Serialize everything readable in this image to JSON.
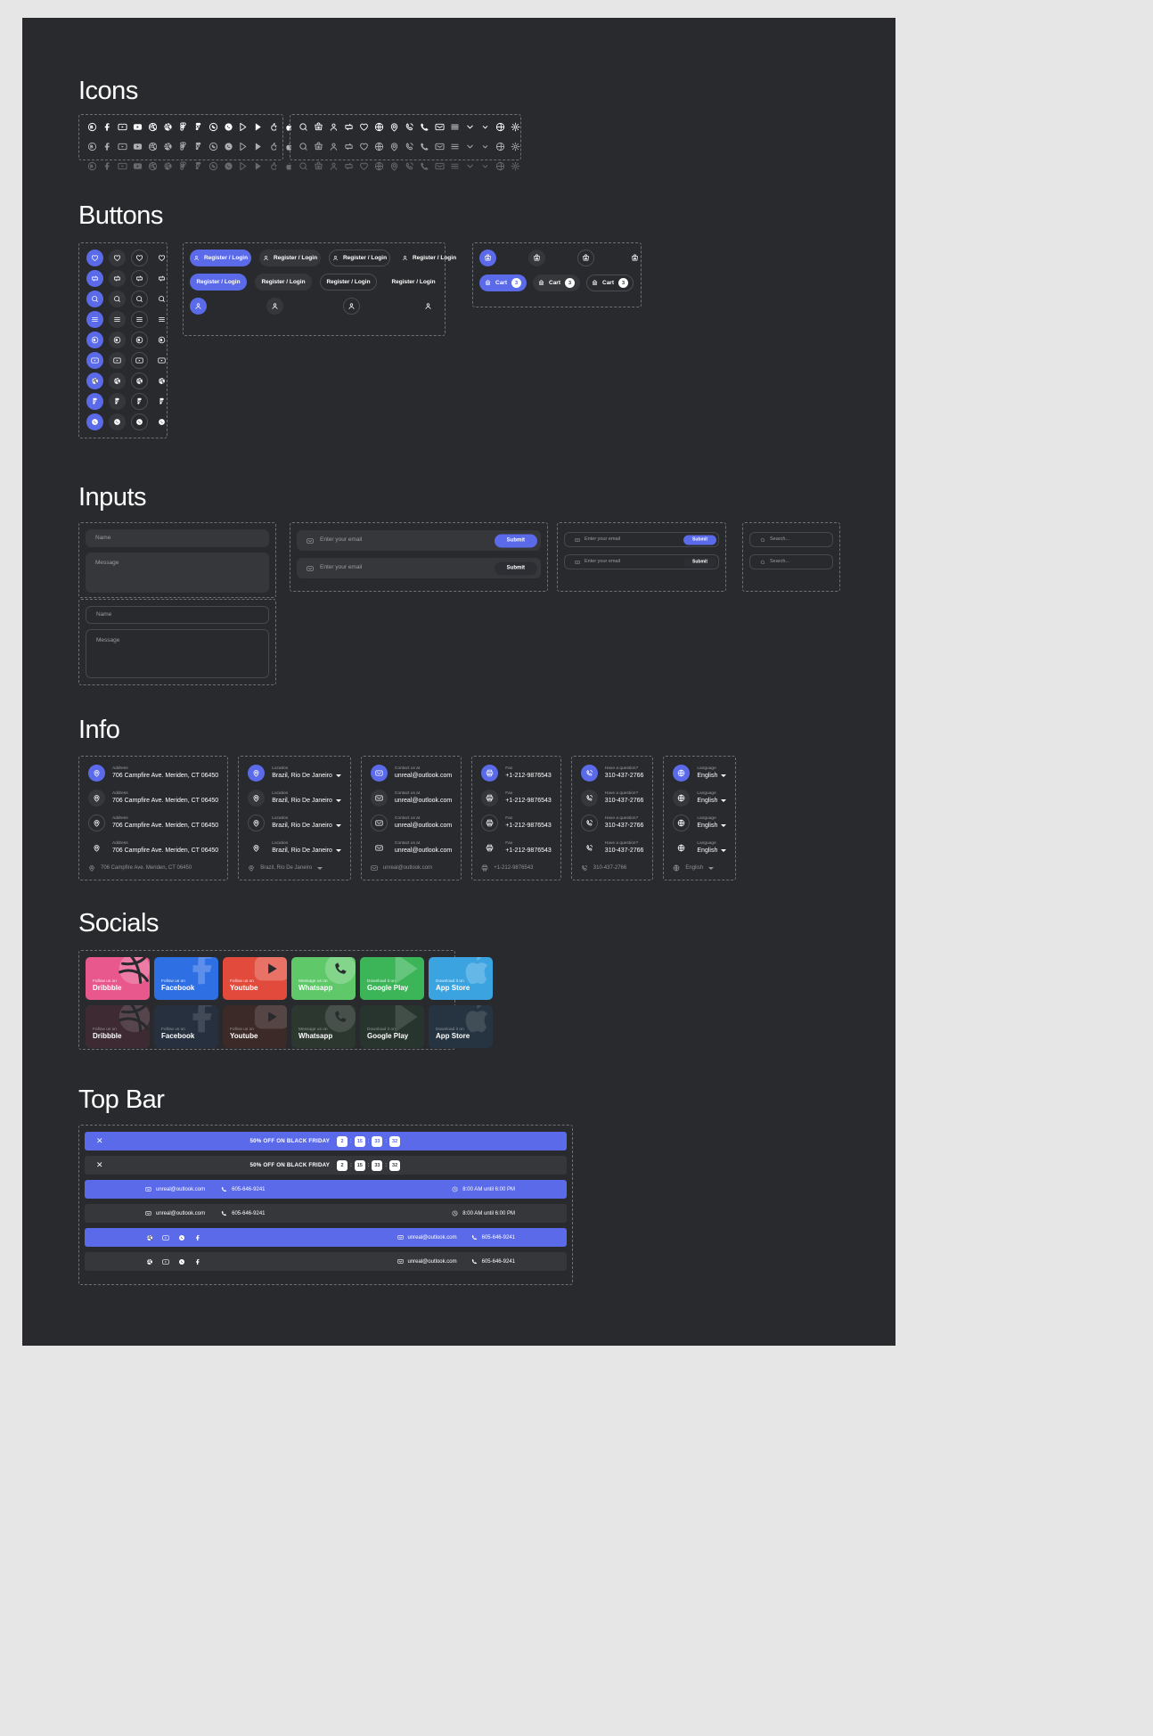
{
  "sections": {
    "icons": "Icons",
    "buttons": "Buttons",
    "inputs": "Inputs",
    "info": "Info",
    "socials": "Socials",
    "topbar": "Top Bar"
  },
  "colors": {
    "accent": "#5b6ae8",
    "canvas": "#282a2e",
    "surface": "#35373b",
    "page": "#e6e6e6",
    "muted_text": "#9a9da3"
  },
  "icons": {
    "brand_set": [
      "behance-icon",
      "facebook-icon",
      "vimeo-icon",
      "youtube-icon",
      "dribbble-outline-icon",
      "dribbble-icon",
      "figma-outline-icon",
      "figma-icon",
      "whatsapp-outline-icon",
      "whatsapp-icon",
      "google-play-outline-icon",
      "google-play-icon",
      "apple-outline-icon",
      "apple-icon"
    ],
    "ui_set": [
      "search-icon",
      "cart-icon",
      "user-icon",
      "compare-icon",
      "heart-icon",
      "globe-icon",
      "location-icon",
      "phone-ring-icon",
      "phone-icon",
      "mail-icon",
      "menu-icon",
      "chevron-down-icon",
      "chevron-down-small-icon",
      "language-globe-icon",
      "settings-icon"
    ],
    "row_opacities": [
      "100%",
      "62%",
      "30%"
    ]
  },
  "buttons": {
    "icon_column": [
      "heart-icon",
      "compare-icon",
      "search-icon",
      "menu-icon",
      "behance-icon",
      "vimeo-icon",
      "dribbble-icon",
      "figma-icon",
      "whatsapp-icon"
    ],
    "variants": [
      "filled",
      "dark",
      "outline",
      "ghost"
    ],
    "register_label": "Register / Login",
    "register_icon": "user-icon",
    "cart": {
      "icon": "cart-icon",
      "trash_icon": "trash-icon",
      "label": "Cart",
      "count": "3",
      "count_blue": "3"
    }
  },
  "inputs": {
    "name_placeholder": "Name",
    "message_placeholder": "Message",
    "email_placeholder": "Enter your email",
    "email_icon": "mail-icon",
    "submit_label": "Submit",
    "search_placeholder": "Search...",
    "search_icon": "search-icon"
  },
  "info": {
    "cards": [
      {
        "icon": "location-icon",
        "label": "Address",
        "value": "706 Campfire Ave. Meriden, CT 06450",
        "compact": "706 Campfire Ave. Meriden, CT 06450",
        "dropdown": false
      },
      {
        "icon": "location-icon",
        "label": "Location",
        "value": "Brazil, Rio De Janeiro",
        "compact": "Brazil, Rio De Janeiro",
        "dropdown": true
      },
      {
        "icon": "mail-icon",
        "label": "Contact us at",
        "value": "unreal@outlook.com",
        "compact": "unreal@outlook.com",
        "dropdown": false
      },
      {
        "icon": "fax-icon",
        "label": "Fax",
        "value": "+1-212-9876543",
        "compact": "+1-212-9876543",
        "dropdown": false
      },
      {
        "icon": "phone-ring-icon",
        "label": "Have a question?",
        "value": "310-437-2766",
        "compact": "310-437-2766",
        "dropdown": false
      },
      {
        "icon": "globe-icon",
        "label": "Language",
        "value": "English",
        "compact": "English",
        "dropdown": true
      }
    ]
  },
  "socials": {
    "cards": [
      {
        "sub": "Follow us on",
        "name": "Dribbble",
        "color": "#e8588c",
        "muted": "#3d2a33",
        "icon": "dribbble-icon"
      },
      {
        "sub": "Follow us on",
        "name": "Facebook",
        "color": "#2f6fe4",
        "muted": "#26303f",
        "icon": "facebook-icon"
      },
      {
        "sub": "Follow us on",
        "name": "Youtube",
        "color": "#e24b3c",
        "muted": "#3c2a29",
        "icon": "youtube-icon"
      },
      {
        "sub": "Message us on",
        "name": "Whatsapp",
        "color": "#5fc96a",
        "muted": "#2c3730",
        "icon": "whatsapp-icon"
      },
      {
        "sub": "Download it on",
        "name": "Google Play",
        "color": "#3cb558",
        "muted": "#27352e",
        "icon": "google-play-icon"
      },
      {
        "sub": "Download it on",
        "name": "App Store",
        "color": "#3aa3e0",
        "muted": "#253440",
        "icon": "apple-icon"
      }
    ]
  },
  "topbar": {
    "close_icon": "close-icon",
    "promo": "50% OFF ON BLACK FRIDAY",
    "countdown": {
      "days": "2",
      "hours": "15",
      "minutes": "33",
      "seconds": "32",
      "separator": ":"
    },
    "email": "unreal@outlook.com",
    "email_icon": "mail-icon",
    "phone": "605-646-9241",
    "phone_icon": "phone-icon",
    "hours": "8:00 AM until 6:00 PM",
    "hours_icon": "clock-icon",
    "socials": [
      "dribbble-icon",
      "vimeo-icon",
      "whatsapp-icon",
      "facebook-icon"
    ]
  }
}
